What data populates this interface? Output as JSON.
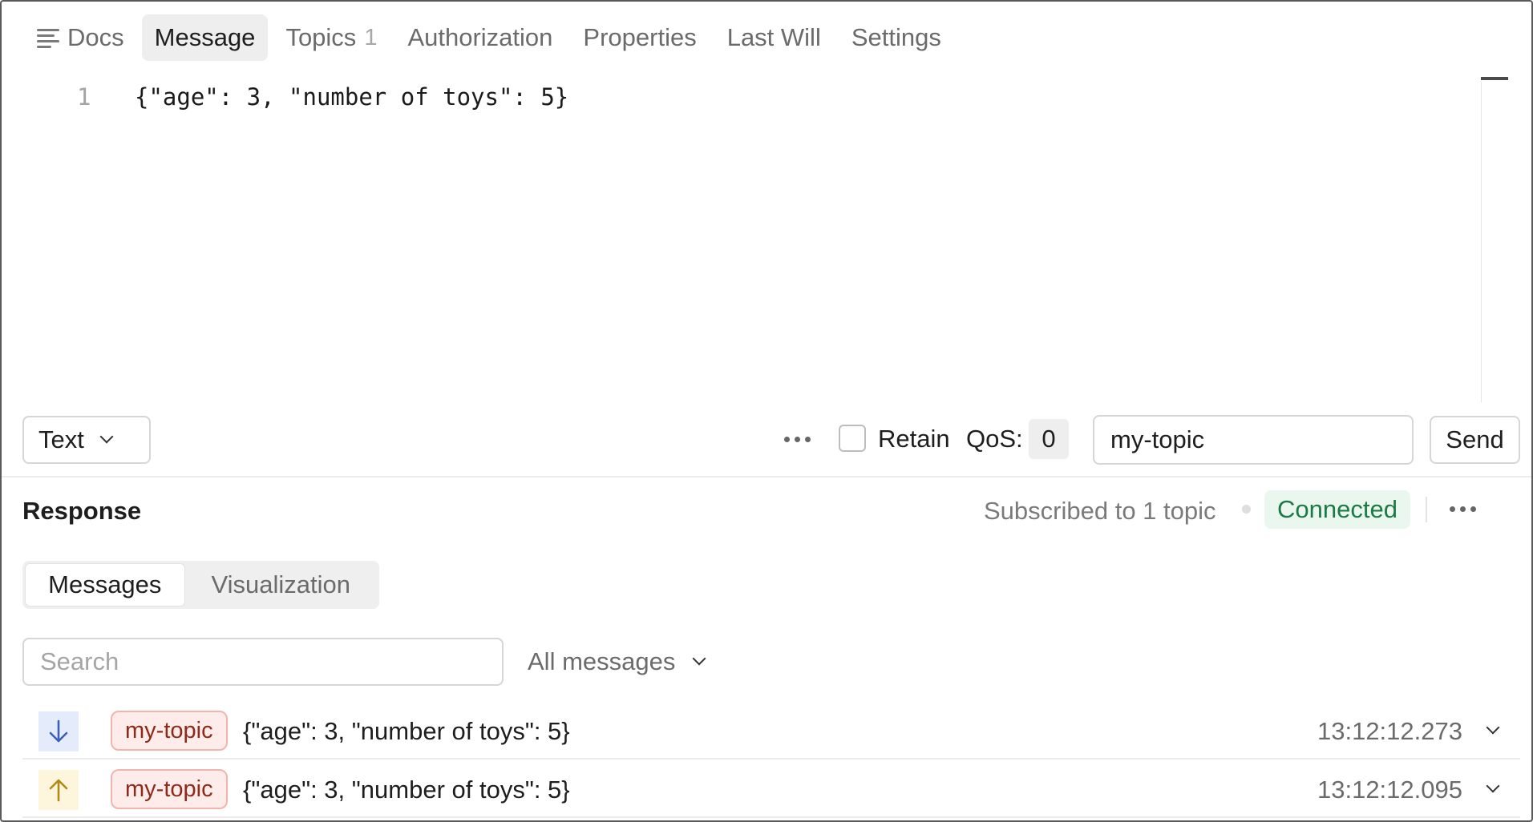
{
  "tabs": [
    {
      "label": "Docs",
      "icon": "docs-icon"
    },
    {
      "label": "Message",
      "active": true
    },
    {
      "label": "Topics",
      "count": "1"
    },
    {
      "label": "Authorization"
    },
    {
      "label": "Properties"
    },
    {
      "label": "Last Will"
    },
    {
      "label": "Settings"
    }
  ],
  "editor": {
    "line_number": "1",
    "content": "{\"age\": 3, \"number of toys\": 5}"
  },
  "toolbar": {
    "format": "Text",
    "retain_label": "Retain",
    "retain_checked": false,
    "qos_label": "QoS:",
    "qos_value": "0",
    "topic_value": "my-topic",
    "send_label": "Send"
  },
  "response": {
    "title": "Response",
    "subscribed_text": "Subscribed to 1 topic",
    "status": "Connected",
    "status_color": "#1c7a46",
    "segments": [
      "Messages",
      "Visualization"
    ],
    "active_segment": "Messages",
    "search_placeholder": "Search",
    "filter_label": "All messages",
    "messages": [
      {
        "direction": "incoming",
        "icon": "arrow-down-icon",
        "topic": "my-topic",
        "payload": "{\"age\": 3, \"number of toys\": 5}",
        "time": "13:12:12.273"
      },
      {
        "direction": "outgoing",
        "icon": "arrow-up-icon",
        "topic": "my-topic",
        "payload": "{\"age\": 3, \"number of toys\": 5}",
        "time": "13:12:12.095"
      }
    ]
  },
  "colors": {
    "incoming_bg": "#e4ecfb",
    "incoming_arrow": "#3f5fb8",
    "outgoing_bg": "#fdf6dc",
    "outgoing_arrow": "#b08a12",
    "topic_tag_bg": "#fdecea",
    "topic_tag_text": "#8f2a1a"
  }
}
